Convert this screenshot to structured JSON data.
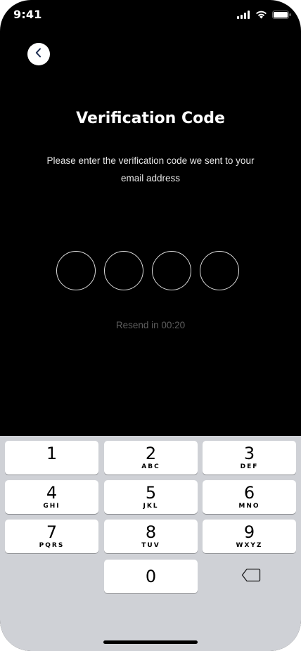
{
  "status_bar": {
    "time": "9:41",
    "icons": [
      "signal-icon",
      "wifi-icon",
      "battery-icon"
    ]
  },
  "header": {
    "back_icon": "chevron-left-icon"
  },
  "main": {
    "title": "Verification Code",
    "subtitle": "Please enter the verification code we sent to your email address",
    "code_digits": [
      "",
      "",
      "",
      ""
    ],
    "resend_text": "Resend in 00:20"
  },
  "keypad": {
    "keys": [
      {
        "num": "1",
        "letters": ""
      },
      {
        "num": "2",
        "letters": "ABC"
      },
      {
        "num": "3",
        "letters": "DEF"
      },
      {
        "num": "4",
        "letters": "GHI"
      },
      {
        "num": "5",
        "letters": "JKL"
      },
      {
        "num": "6",
        "letters": "MNO"
      },
      {
        "num": "7",
        "letters": "PQRS"
      },
      {
        "num": "8",
        "letters": "TUV"
      },
      {
        "num": "9",
        "letters": "WXYZ"
      },
      {
        "num": "0",
        "letters": ""
      }
    ],
    "delete_icon": "backspace-icon"
  },
  "colors": {
    "background": "#000000",
    "keyboard_bg": "#cfd1d6",
    "key_bg": "#ffffff",
    "resend_text": "#5e5e5e"
  }
}
